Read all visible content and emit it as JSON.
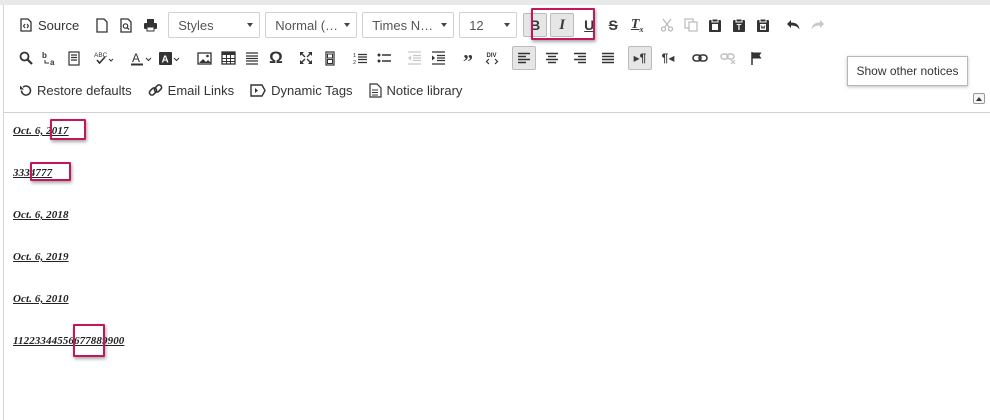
{
  "toolbar": {
    "source_label": "Source",
    "styles_value": "Styles",
    "format_value": "Normal (…",
    "font_value": "Times N…",
    "size_value": "12",
    "restore_defaults_label": "Restore defaults",
    "email_links_label": "Email Links",
    "dynamic_tags_label": "Dynamic Tags",
    "notice_library_label": "Notice library"
  },
  "tooltip": {
    "text": "Show other notices"
  },
  "editor": {
    "lines": [
      "Oct. 6, 2017",
      "3334777",
      "Oct. 6, 2018",
      "Oct. 6, 2019",
      "Oct. 6, 2010",
      "11223344556677889900"
    ]
  },
  "colors": {
    "highlight": "#c2185b",
    "button_active_bg": "#e6e6e6",
    "toolbar_border": "#d1d1d1"
  }
}
